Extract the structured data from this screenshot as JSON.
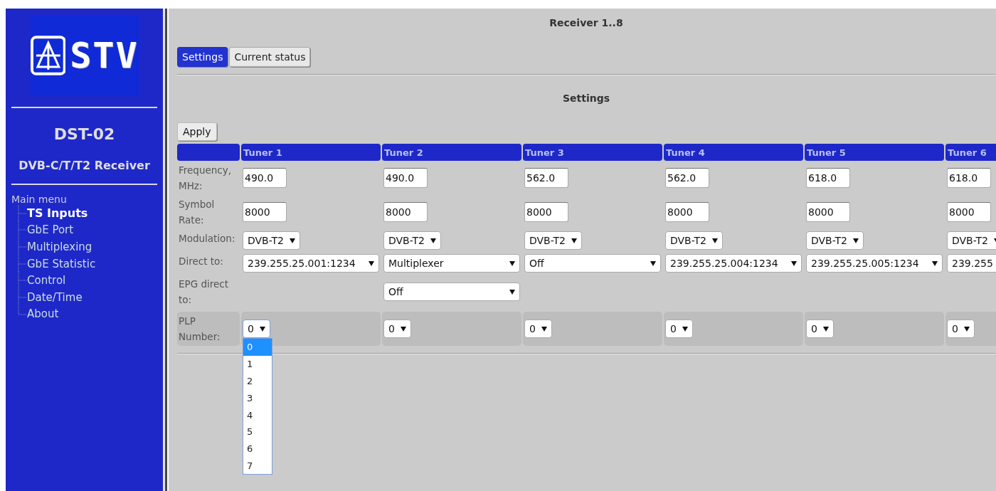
{
  "sidebar": {
    "logo_text": "STV",
    "device": "DST-02",
    "subtitle": "DVB-C/T/T2 Receiver",
    "menu_title": "Main menu",
    "items": [
      {
        "label": "TS Inputs",
        "selected": true
      },
      {
        "label": "GbE Port",
        "selected": false
      },
      {
        "label": "Multiplexing",
        "selected": false
      },
      {
        "label": "GbE Statistic",
        "selected": false
      },
      {
        "label": "Control",
        "selected": false
      },
      {
        "label": "Date/Time",
        "selected": false
      },
      {
        "label": "About",
        "selected": false
      }
    ]
  },
  "page_title": "Receiver 1..8",
  "tabs": [
    {
      "label": "Settings",
      "selected": true
    },
    {
      "label": "Current status",
      "selected": false
    }
  ],
  "section_title": "Settings",
  "apply_button": "Apply",
  "row_labels": {
    "frequency": "Frequency, MHz:",
    "symbol_rate": "Symbol Rate:",
    "modulation": "Modulation:",
    "direct_to": "Direct to:",
    "epg_direct_to": "EPG direct to:",
    "plp": "PLP Number:"
  },
  "tuners": [
    {
      "name": "Tuner 1",
      "frequency": "490.0",
      "symbol_rate": "8000",
      "modulation": "DVB-T2",
      "direct_to": "239.255.25.001:1234",
      "plp": "0",
      "plp_open": true
    },
    {
      "name": "Tuner 2",
      "frequency": "490.0",
      "symbol_rate": "8000",
      "modulation": "DVB-T2",
      "direct_to": "Multiplexer",
      "epg_direct_to": "Off",
      "plp": "0",
      "plp_open": false
    },
    {
      "name": "Tuner 3",
      "frequency": "562.0",
      "symbol_rate": "8000",
      "modulation": "DVB-T2",
      "direct_to": "Off",
      "plp": "0",
      "plp_open": false
    },
    {
      "name": "Tuner 4",
      "frequency": "562.0",
      "symbol_rate": "8000",
      "modulation": "DVB-T2",
      "direct_to": "239.255.25.004:1234",
      "plp": "0",
      "plp_open": false
    },
    {
      "name": "Tuner 5",
      "frequency": "618.0",
      "symbol_rate": "8000",
      "modulation": "DVB-T2",
      "direct_to": "239.255.25.005:1234",
      "plp": "0",
      "plp_open": false
    },
    {
      "name": "Tuner 6",
      "frequency": "618.0",
      "symbol_rate": "8000",
      "modulation": "DVB-T2",
      "direct_to": "239.255",
      "plp": "0",
      "plp_open": false
    }
  ],
  "plp_options": [
    {
      "label": "0",
      "selected": true
    },
    {
      "label": "1",
      "selected": false
    },
    {
      "label": "2",
      "selected": false
    },
    {
      "label": "3",
      "selected": false
    },
    {
      "label": "4",
      "selected": false
    },
    {
      "label": "5",
      "selected": false
    },
    {
      "label": "6",
      "selected": false
    },
    {
      "label": "7",
      "selected": false
    }
  ]
}
